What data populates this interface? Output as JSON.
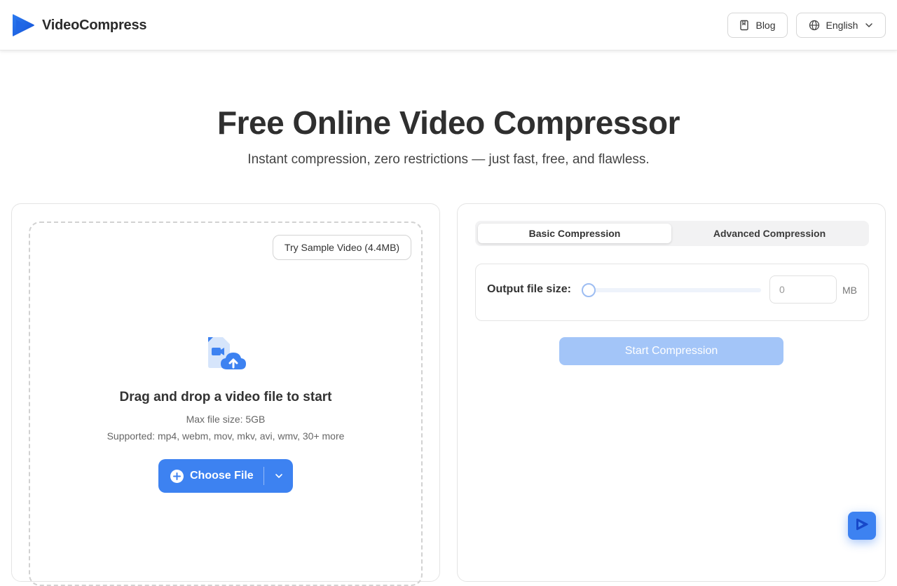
{
  "header": {
    "logo_text": "VideoCompress",
    "logo_icon": "play-triangle-icon",
    "blog_label": "Blog",
    "language_label": "English"
  },
  "hero": {
    "title": "Free Online Video Compressor",
    "subtitle": "Instant compression, zero restrictions — just fast, free, and flawless."
  },
  "upload": {
    "sample_button": "Try Sample Video (4.4MB)",
    "drop_title": "Drag and drop a video file to start",
    "max_size": "Max file size: 5GB",
    "supported": "Supported: mp4, webm, mov, mkv, avi, wmv, 30+ more",
    "choose_file_label": "Choose File"
  },
  "compression": {
    "tabs": [
      {
        "label": "Basic Compression",
        "active": true
      },
      {
        "label": "Advanced Compression",
        "active": false
      }
    ],
    "output_size_label": "Output file size:",
    "output_size_value": "0",
    "output_size_unit": "MB",
    "slider_value": 0,
    "start_button": "Start Compression"
  },
  "colors": {
    "accent": "#3d82f1",
    "accent_disabled": "#a3c5f8"
  }
}
